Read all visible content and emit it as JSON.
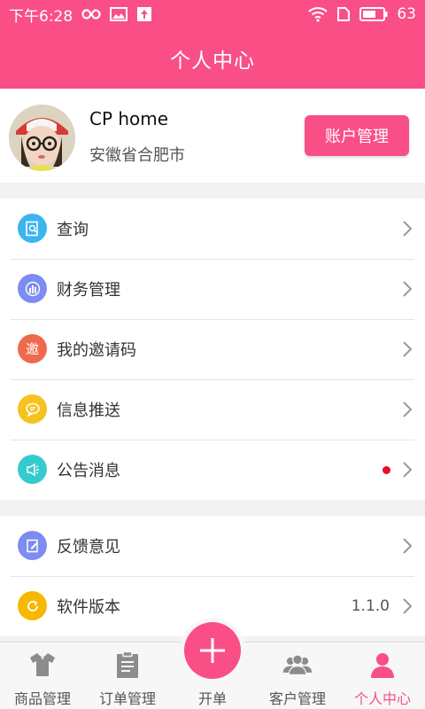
{
  "status_bar": {
    "time": "下午6:28",
    "battery": "63",
    "icons": [
      "infinity-icon",
      "image-icon",
      "upload-icon",
      "wifi-icon",
      "sim-icon",
      "battery-icon"
    ]
  },
  "header": {
    "title": "个人中心"
  },
  "profile": {
    "name": "CP home",
    "location": "安徽省合肥市",
    "account_button": "账户管理"
  },
  "menu_group_1": [
    {
      "label": "查询",
      "icon": "search-doc-icon",
      "color": "#3cb4ef"
    },
    {
      "label": "财务管理",
      "icon": "finance-icon",
      "color": "#7d8cf0"
    },
    {
      "label": "我的邀请码",
      "icon": "invite-icon",
      "color": "#ef6a4d",
      "glyph": "邀"
    },
    {
      "label": "信息推送",
      "icon": "message-icon",
      "color": "#f6c21e"
    },
    {
      "label": "公告消息",
      "icon": "announcement-icon",
      "color": "#34cbcf",
      "has_dot": true
    }
  ],
  "menu_group_2": [
    {
      "label": "反馈意见",
      "icon": "feedback-icon",
      "color": "#7d8cf0"
    },
    {
      "label": "软件版本",
      "icon": "refresh-icon",
      "color": "#f6b800",
      "value": "1.1.0"
    }
  ],
  "tabs": [
    {
      "label": "商品管理",
      "icon": "shirt-icon"
    },
    {
      "label": "订单管理",
      "icon": "clipboard-icon"
    },
    {
      "label": "开单",
      "icon": "plus-icon"
    },
    {
      "label": "客户管理",
      "icon": "customers-icon"
    },
    {
      "label": "个人中心",
      "icon": "person-icon",
      "active": true
    }
  ],
  "colors": {
    "brand": "#f94f86",
    "background": "#f2f2f2"
  }
}
